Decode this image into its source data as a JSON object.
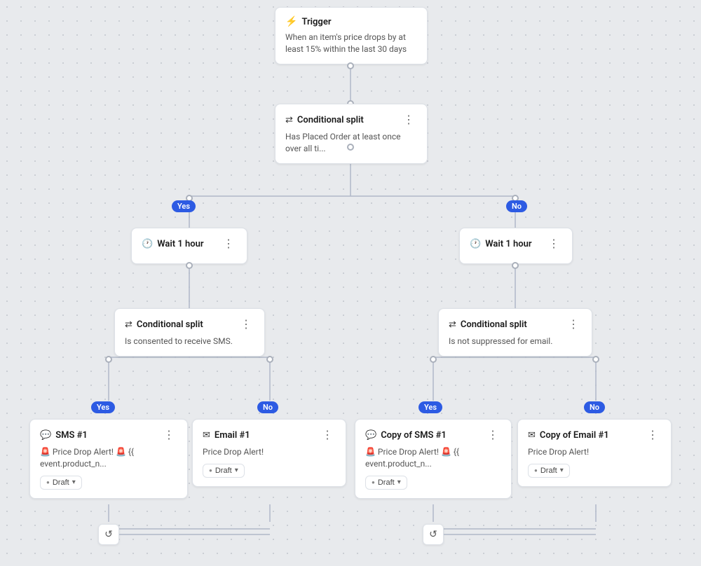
{
  "nodes": {
    "trigger": {
      "title": "Trigger",
      "body": "When an item's price drops by at least 15% within the last 30 days"
    },
    "conditional_split_top": {
      "title": "Conditional split",
      "body": "Has Placed Order at least once over all ti..."
    },
    "wait_left": {
      "title": "Wait 1 hour"
    },
    "wait_right": {
      "title": "Wait 1 hour"
    },
    "conditional_split_left": {
      "title": "Conditional split",
      "body": "Is consented to receive SMS."
    },
    "conditional_split_right": {
      "title": "Conditional split",
      "body": "Is not suppressed for email."
    },
    "sms1": {
      "title": "SMS #1",
      "body": "🚨 Price Drop Alert! 🚨 {{ event.product_n...",
      "status": "Draft"
    },
    "email1": {
      "title": "Email #1",
      "body": "Price Drop Alert!",
      "status": "Draft"
    },
    "copy_sms1": {
      "title": "Copy of SMS #1",
      "body": "🚨 Price Drop Alert! 🚨 {{ event.product_n...",
      "status": "Draft"
    },
    "copy_email1": {
      "title": "Copy of Email #1",
      "body": "Price Drop Alert!",
      "status": "Draft"
    }
  },
  "badges": {
    "yes_left": "Yes",
    "no_left": "No",
    "yes_right": "Yes",
    "no_right": "No"
  },
  "icons": {
    "trigger": "⚡",
    "split": "⇄",
    "wait": "🕐",
    "sms": "💬",
    "email": "✉",
    "more": "⋮",
    "draft_icon": "●",
    "chevron": "▾",
    "loop": "↺"
  }
}
